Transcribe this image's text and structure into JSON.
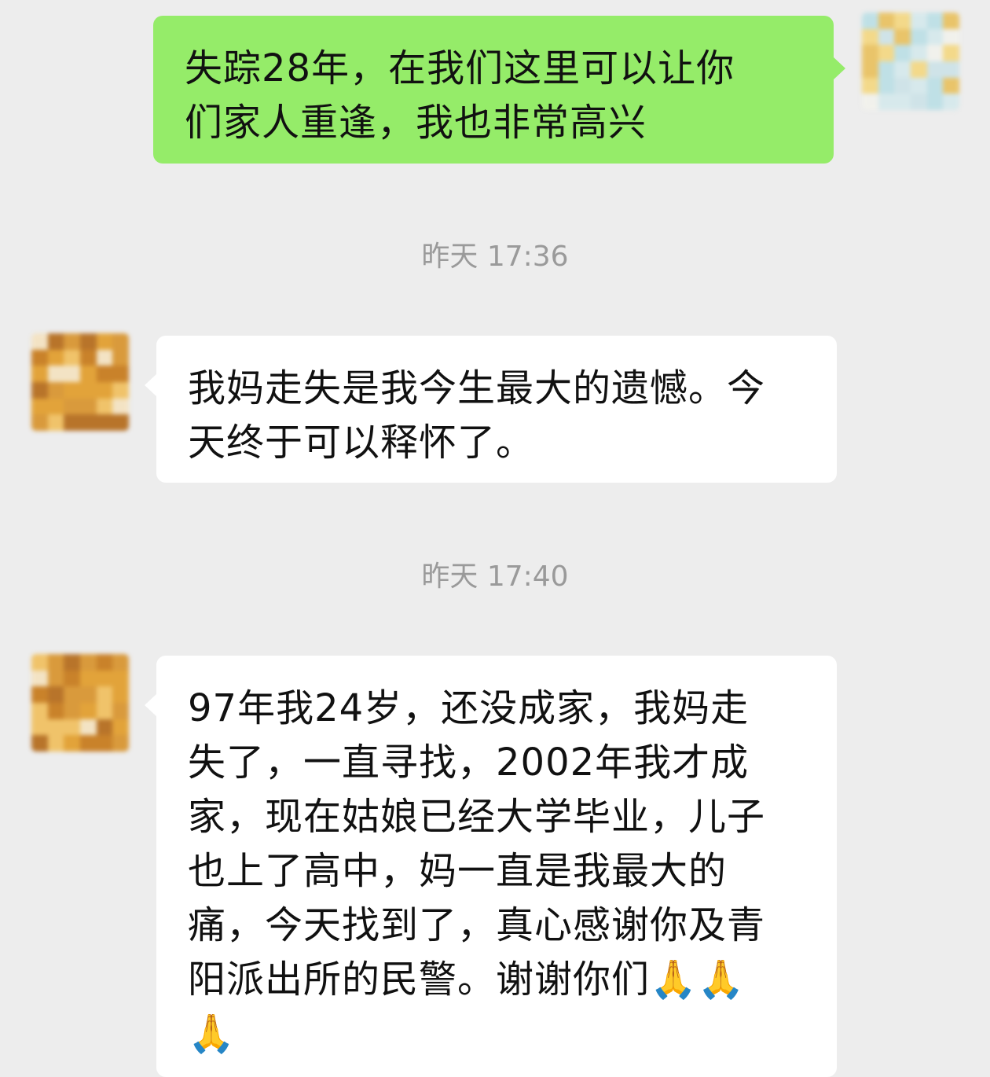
{
  "colors": {
    "background": "#ededed",
    "outgoing_bubble": "#95ec69",
    "incoming_bubble": "#ffffff",
    "timestamp_text": "#9a9a9a",
    "message_text": "#111111"
  },
  "avatars": {
    "self": {
      "icon": "avatar-icon",
      "palette": [
        "#f3d98a",
        "#d7e9ec",
        "#bfe0e6",
        "#e9c46a",
        "#f1f1ec",
        "#cfe3e8"
      ]
    },
    "peer": {
      "icon": "avatar-icon",
      "palette": [
        "#e2a33a",
        "#c9822a",
        "#f0c36a",
        "#b8742a",
        "#f3e3c4",
        "#d99a3c"
      ]
    }
  },
  "messages": [
    {
      "direction": "out",
      "lines": [
        "失踪28年，在我们这里可以让你",
        "们家人重逢，我也非常高兴"
      ]
    },
    {
      "type": "timestamp",
      "text": "昨天 17:36"
    },
    {
      "direction": "in",
      "lines": [
        "我妈走失是我今生最大的遗憾。今",
        "天终于可以释怀了。"
      ]
    },
    {
      "type": "timestamp",
      "text": "昨天 17:40"
    },
    {
      "direction": "in",
      "lines": [
        "97年我24岁，还没成家，我妈走",
        "失了，一直寻找，2002年我才成",
        "家，现在姑娘已经大学毕业，儿子",
        "也上了高中，妈一直是我最大的",
        "痛，今天找到了，真心感谢你及青",
        "阳派出所的民警。谢谢你们🙏🙏",
        "🙏"
      ],
      "emoji_icon": "folded-hands-emoji"
    }
  ]
}
